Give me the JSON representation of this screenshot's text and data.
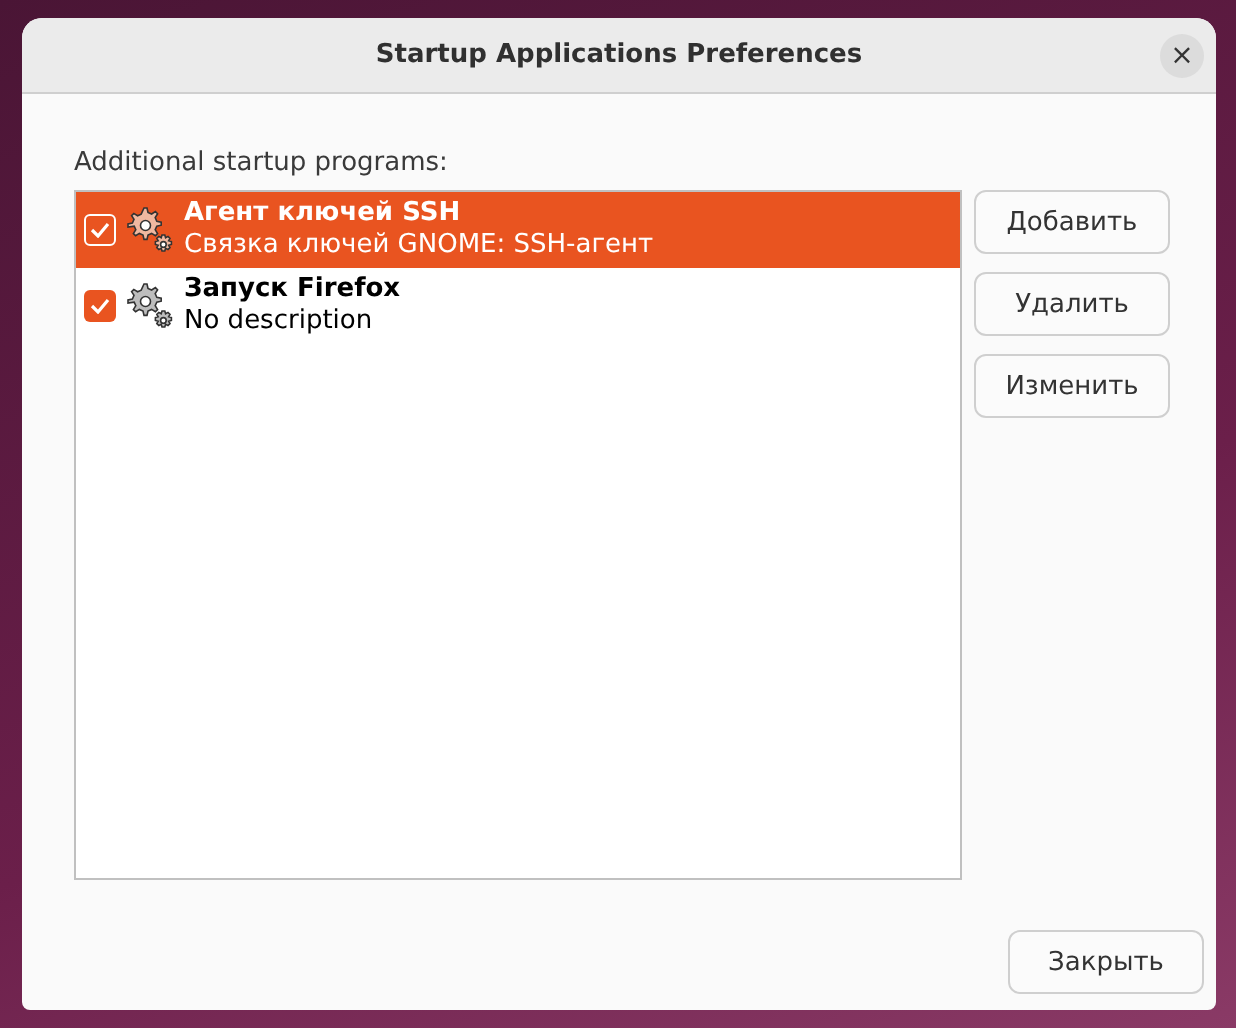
{
  "window": {
    "title": "Startup Applications Preferences",
    "close": "×"
  },
  "list_label": "Additional startup programs:",
  "programs": [
    {
      "name": "Агент ключей SSH",
      "description": "Связка ключей GNOME: SSH-агент",
      "checked": true,
      "selected": true
    },
    {
      "name": "Запуск Firefox",
      "description": "No description",
      "checked": true,
      "selected": false
    }
  ],
  "side_buttons": [
    "Добавить",
    "Удалить",
    "Изменить"
  ],
  "close_button": "Закрыть"
}
